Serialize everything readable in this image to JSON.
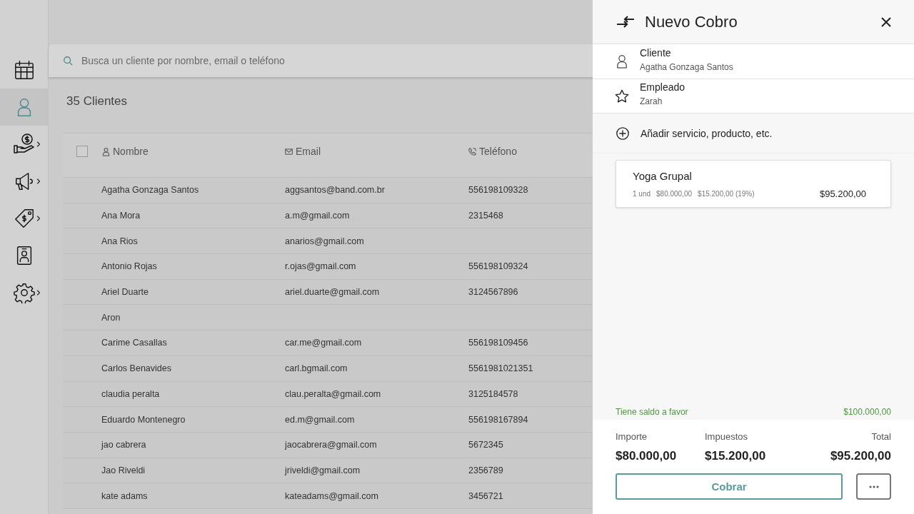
{
  "sidebar": {
    "items": [
      {
        "kind": "calendar",
        "selected": false,
        "expandable": false
      },
      {
        "kind": "person",
        "selected": true,
        "expandable": false
      },
      {
        "kind": "money",
        "selected": false,
        "expandable": true
      },
      {
        "kind": "megaphone",
        "selected": false,
        "expandable": true
      },
      {
        "kind": "tag",
        "selected": false,
        "expandable": true
      },
      {
        "kind": "badge",
        "selected": false,
        "expandable": false
      },
      {
        "kind": "gear",
        "selected": false,
        "expandable": true
      }
    ]
  },
  "search": {
    "placeholder": "Busca un cliente por nombre, email o teléfono"
  },
  "count": "35 Clientes",
  "table": {
    "select_all": {
      "checked": false
    },
    "columns": [
      {
        "label": "Nombre",
        "kind": "person"
      },
      {
        "label": "Email",
        "kind": "mail"
      },
      {
        "label": "Teléfono",
        "kind": "phone"
      }
    ],
    "rows": [
      [
        "Agatha Gonzaga Santos",
        "aggsantos@band.com.br",
        "556198109328"
      ],
      [
        "Ana Mora",
        "a.m@gmail.com",
        "2315468"
      ],
      [
        "Ana Rios",
        "anarios@gmail.com",
        null
      ],
      [
        "Antonio Rojas",
        "r.ojas@gmail.com",
        "556198109324"
      ],
      [
        "Ariel Duarte",
        "ariel.duarte@gmail.com",
        "3124567896"
      ],
      [
        "Aron",
        null,
        null
      ],
      [
        "Carime Casallas",
        "car.me@gmail.com",
        "556198109456"
      ],
      [
        "Carlos Benavides",
        "carl.bgmail.com",
        "5561981021351"
      ],
      [
        "claudia peralta",
        "clau.peralta@gmail.com",
        "3125184578"
      ],
      [
        "Eduardo Montenegro",
        "ed.m@gmail.com",
        "556198167894"
      ],
      [
        "jao cabrera",
        "jaocabrera@gmail.com",
        "5672345"
      ],
      [
        "Jao Riveldi",
        "jriveldi@gmail.com",
        "2356789"
      ],
      [
        "kate adams",
        "kateadams@gmail.com",
        "3456721"
      ]
    ]
  },
  "drawer": {
    "title": "Nuevo Cobro",
    "fields": [
      {
        "kind": "person",
        "label": "Cliente",
        "value": "Agatha Gonzaga Santos"
      },
      {
        "kind": "star",
        "label": "Empleado",
        "value": "Zarah"
      }
    ],
    "add_action": "Añadir servicio, producto, etc.",
    "items": [
      {
        "name": "Yoga Grupal",
        "quantity": "1 und",
        "price": "$80.000,00",
        "tax": "$15.200,00 (19%)",
        "total": "$95.200,00"
      }
    ],
    "balance": {
      "label": "Tiene saldo a favor",
      "amount": "$100.000,00"
    },
    "totals": [
      {
        "label": "Importe",
        "value": "$80.000,00"
      },
      {
        "label": "Impuestos",
        "value": "$15.200,00"
      },
      {
        "label": "Total",
        "value": "$95.200,00"
      }
    ],
    "charge_button": "Cobrar"
  }
}
